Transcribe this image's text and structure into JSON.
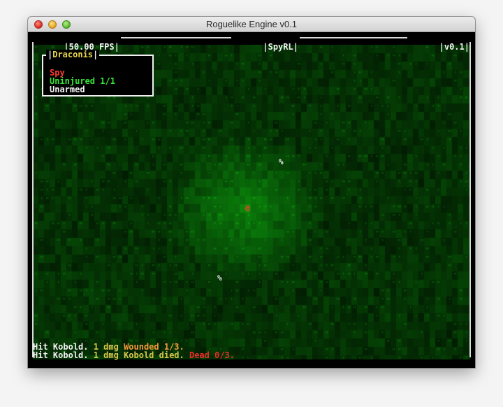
{
  "window": {
    "title": "Roguelike Engine v0.1"
  },
  "hud": {
    "fps": "50.00 FPS",
    "game_name": "SpyRL",
    "version": "v0.1"
  },
  "panel": {
    "title": "Draconis",
    "class": "Spy",
    "health": "Uninjured 1/1",
    "weapon": "Unarmed"
  },
  "map": {
    "player_glyph": "@",
    "item_glyph_1": "%",
    "item_glyph_2": "%"
  },
  "log": [
    {
      "prefix": "Hit Kobold. ",
      "dmg": "1 dmg ",
      "status": "Wounded 1/3."
    },
    {
      "prefix": "Hit Kobold. ",
      "dmg": "1 dmg ",
      "status": "Kobold died. ",
      "dead": "Dead 0/3."
    }
  ],
  "colors": {
    "player": "#ff3b30",
    "class_text": "#ff3b30",
    "health_text": "#35e635",
    "weapon_text": "#f2f2f2",
    "panel_title": "#e6d84d",
    "grass_dark": "#0a2a0a",
    "grass_light": "#3aa03a"
  }
}
